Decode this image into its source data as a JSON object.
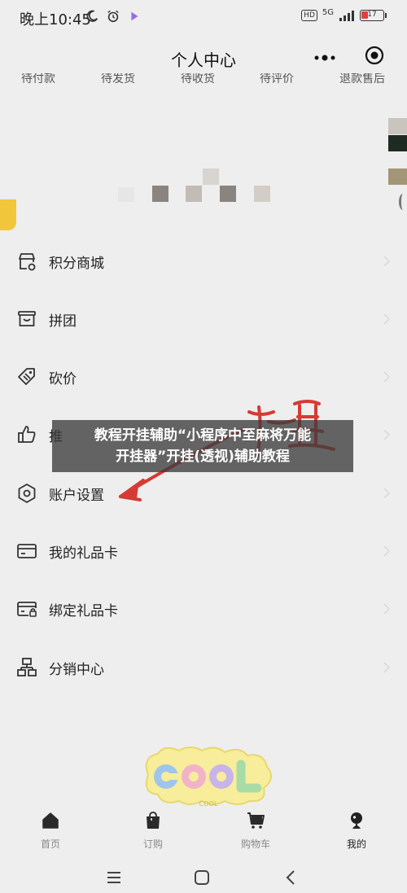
{
  "status_bar": {
    "time": "晚上10:45",
    "network_type": "5G",
    "hd_label": "HD",
    "battery_level": "17"
  },
  "header": {
    "title": "个人中心"
  },
  "order_strip": [
    "待付款",
    "待发货",
    "待收货",
    "待评价",
    "退款售后"
  ],
  "menu": [
    {
      "label": "积分商城",
      "icon": "store-icon"
    },
    {
      "label": "拼团",
      "icon": "shopping-basket-icon"
    },
    {
      "label": "砍价",
      "icon": "tag-icon"
    },
    {
      "label": "推",
      "icon": "thumbs-up-icon"
    },
    {
      "label": "账户设置",
      "icon": "hexagon-settings-icon"
    },
    {
      "label": "我的礼品卡",
      "icon": "card-icon"
    },
    {
      "label": "绑定礼品卡",
      "icon": "card-bind-icon"
    },
    {
      "label": "分销中心",
      "icon": "org-chart-icon"
    }
  ],
  "overlay_banner": {
    "line1": "教程开挂辅助“小程序中至麻将万能",
    "line2": "开挂器”开挂(透视)辅助教程"
  },
  "annotation_text": "设置",
  "sticker_text": "COOL",
  "tabs": [
    {
      "label": "首页",
      "icon": "home-icon",
      "active": false
    },
    {
      "label": "订购",
      "icon": "shopping-bag-icon",
      "active": false
    },
    {
      "label": "购物车",
      "icon": "cart-icon",
      "active": false
    },
    {
      "label": "我的",
      "icon": "user-icon",
      "active": true
    }
  ],
  "colors": {
    "background": "#eeeeee",
    "annotation_red": "#d63a34",
    "banner_bg": "#3c3c3c"
  }
}
